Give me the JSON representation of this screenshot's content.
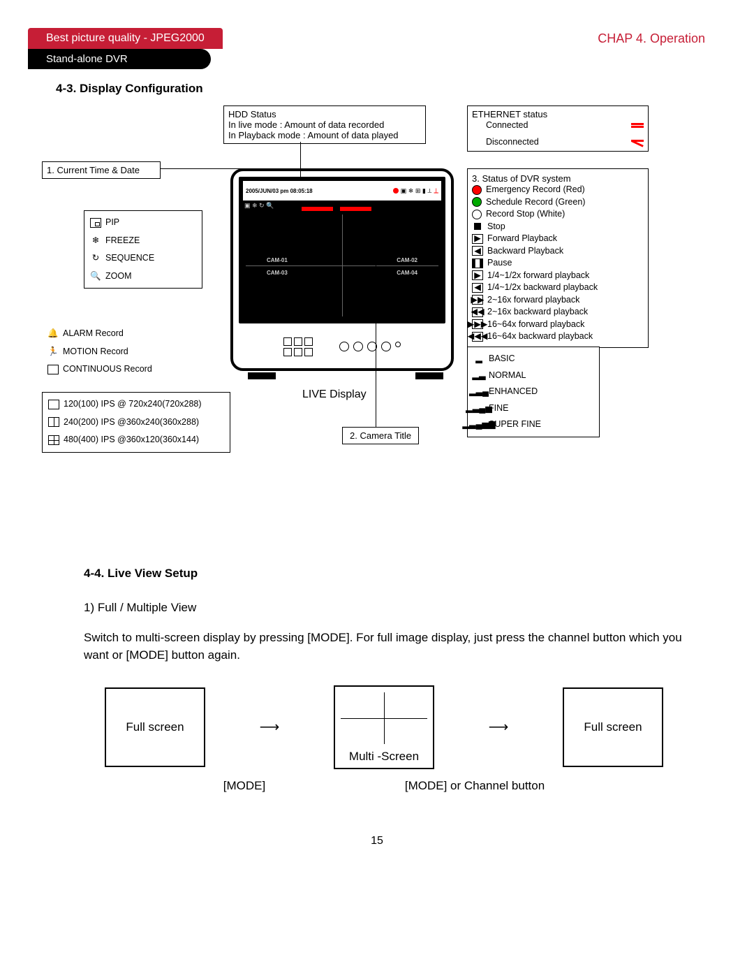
{
  "header": {
    "product_line": "Best picture quality - JPEG2000",
    "product": "Stand-alone DVR",
    "chapter": "CHAP 4. Operation"
  },
  "section1": {
    "title": "4-3. Display Configuration",
    "hdd_box": {
      "l1": "HDD Status",
      "l2": "In live mode : Amount of data recorded",
      "l3": "In Playback mode : Amount of data played"
    },
    "ethernet_box": {
      "title": "ETHERNET status",
      "connected": "Connected",
      "disconnected": "Disconnected"
    },
    "time_box": "1. Current Time & Date",
    "mode_icons": {
      "pip": "PIP",
      "freeze": "FREEZE",
      "sequence": "SEQUENCE",
      "zoom": "ZOOM"
    },
    "record_icons": {
      "alarm": "ALARM Record",
      "motion": "MOTION Record",
      "continuous": "CONTINUOUS Record"
    },
    "ips_box": {
      "l1": "120(100) IPS @ 720x240(720x288)",
      "l2": "240(200) IPS @360x240(360x288)",
      "l3": "480(400) IPS @360x120(360x144)"
    },
    "status_box": {
      "title": "3. Status of DVR system",
      "items": [
        "Emergency Record (Red)",
        "Schedule Record (Green)",
        "Record Stop (White)",
        "Stop",
        "Forward Playback",
        "Backward Playback",
        "Pause",
        "1/4~1/2x forward playback",
        "1/4~1/2x backward playback",
        "2~16x forward playback",
        "2~16x backward playback",
        "16~64x forward playback",
        "16~64x backward playback"
      ]
    },
    "quality_box": {
      "items": [
        "BASIC",
        "NORMAL",
        "ENHANCED",
        "FINE",
        "SUPER FINE"
      ]
    },
    "monitor": {
      "timestamp": "2005/JUN/03 pm 08:05:18",
      "cameras": [
        "CAM-01",
        "CAM-02",
        "CAM-03",
        "CAM-04"
      ]
    },
    "live_display": "LIVE Display",
    "camera_title": "2. Camera Title"
  },
  "section2": {
    "title": "4-4. Live View Setup",
    "item1": "1) Full / Multiple View",
    "para": "Switch to multi-screen display by pressing [MODE]. For full image display, just press the channel button which you want or [MODE] button again.",
    "full_screen": "Full screen",
    "multi_screen": "Multi -Screen",
    "mode_btn": "[MODE]",
    "mode_or_channel": "[MODE] or Channel button"
  },
  "page_number": "15"
}
